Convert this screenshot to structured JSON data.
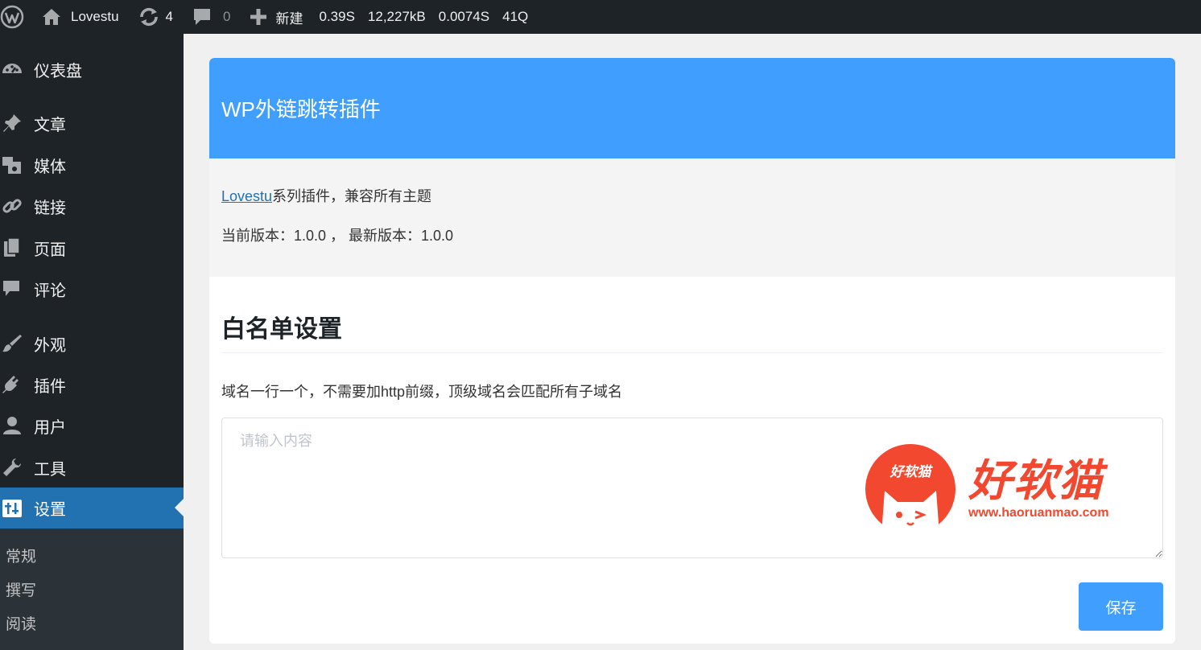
{
  "adminbar": {
    "site_name": "Lovestu",
    "updates_count": "4",
    "comments_count": "0",
    "new_label": "新建",
    "stats": [
      "0.39S",
      "12,227kB",
      "0.0074S",
      "41Q"
    ],
    "icons": [
      "wordpress-logo-icon",
      "home-icon",
      "refresh-icon",
      "comment-icon",
      "plus-icon"
    ]
  },
  "sidebar": {
    "items": [
      {
        "label": "仪表盘",
        "icon": "dashboard-icon"
      },
      {
        "label": "文章",
        "icon": "pin-icon"
      },
      {
        "label": "媒体",
        "icon": "media-icon"
      },
      {
        "label": "链接",
        "icon": "link-icon"
      },
      {
        "label": "页面",
        "icon": "page-icon"
      },
      {
        "label": "评论",
        "icon": "comment-icon"
      },
      {
        "label": "外观",
        "icon": "brush-icon"
      },
      {
        "label": "插件",
        "icon": "plug-icon"
      },
      {
        "label": "用户",
        "icon": "user-icon"
      },
      {
        "label": "工具",
        "icon": "wrench-icon"
      },
      {
        "label": "设置",
        "icon": "settings-icon",
        "active": true
      }
    ],
    "submenu": [
      "常规",
      "撰写",
      "阅读"
    ],
    "colors": {
      "background": "#1d2327",
      "active": "#2271b1",
      "submenu_bg": "#2c3338"
    }
  },
  "plugin": {
    "header_title": "WP外链跳转插件",
    "series_link": "Lovestu",
    "series_text": "系列插件，兼容所有主题",
    "version_text": "当前版本：1.0.0 ， 最新版本：1.0.0"
  },
  "whitelist": {
    "title": "白名单设置",
    "description": "域名一行一个，不需要加http前缀，顶级域名会匹配所有子域名",
    "textarea_value": "",
    "placeholder": "请输入内容",
    "save_label": "保存"
  },
  "watermark": {
    "circle_text": "好软猫",
    "big_text": "好软猫",
    "url": "www.haoruanmao.com",
    "color": "#f2482f"
  },
  "colors": {
    "accent": "#409eff",
    "link": "#2271b1"
  }
}
